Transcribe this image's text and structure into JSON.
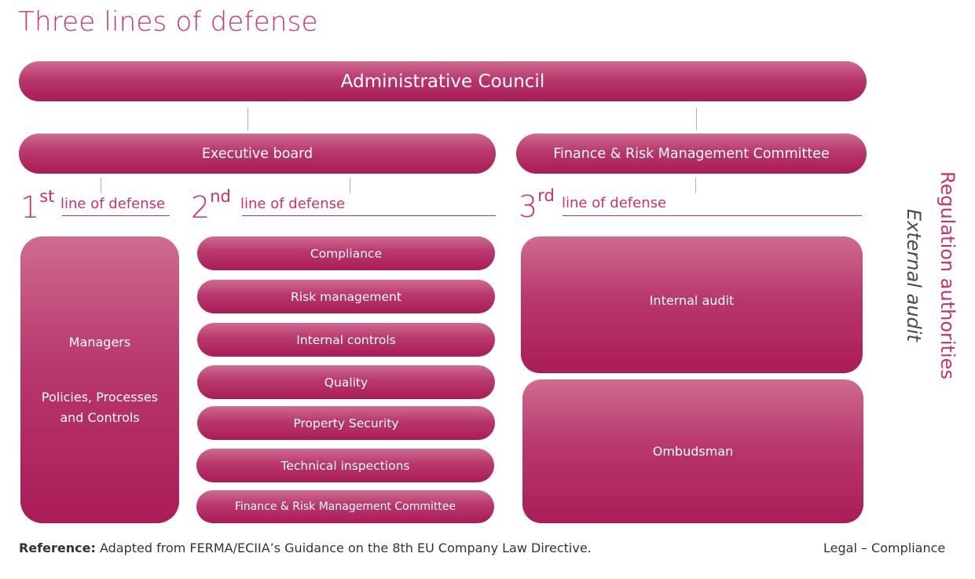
{
  "title": "Three lines of defense",
  "top": {
    "council": "Administrative Council",
    "executive": "Executive board",
    "finance_committee": "Finance & Risk Management Committee"
  },
  "lines": {
    "first": {
      "num": "1",
      "suffix": "st",
      "text": "line of defense"
    },
    "second": {
      "num": "2",
      "suffix": "nd",
      "text": "line of defense"
    },
    "third": {
      "num": "3",
      "suffix": "rd",
      "text": "line of defense"
    }
  },
  "first_line": {
    "managers": "Managers",
    "policies_1": "Policies, Processes",
    "policies_2": "and Controls"
  },
  "second_line": {
    "items": [
      "Compliance",
      "Risk management",
      "Internal controls",
      "Quality",
      "Property Security",
      "Technical inspections",
      "Finance & Risk Management Committee"
    ]
  },
  "third_line": {
    "internal_audit": "Internal audit",
    "ombudsman": "Ombudsman"
  },
  "side": {
    "external_audit": "External audit",
    "regulation": "Regulation authorities"
  },
  "footer": {
    "reference_label": "Reference:",
    "reference_text": "Adapted from FERMA/ECIIA’s Guidance on the 8th EU Company Law Directive.",
    "right": "Legal – Compliance"
  },
  "colors": {
    "accent": "#c8326f",
    "pill_top": "#cf6b91",
    "pill_bottom": "#aa1c57"
  }
}
